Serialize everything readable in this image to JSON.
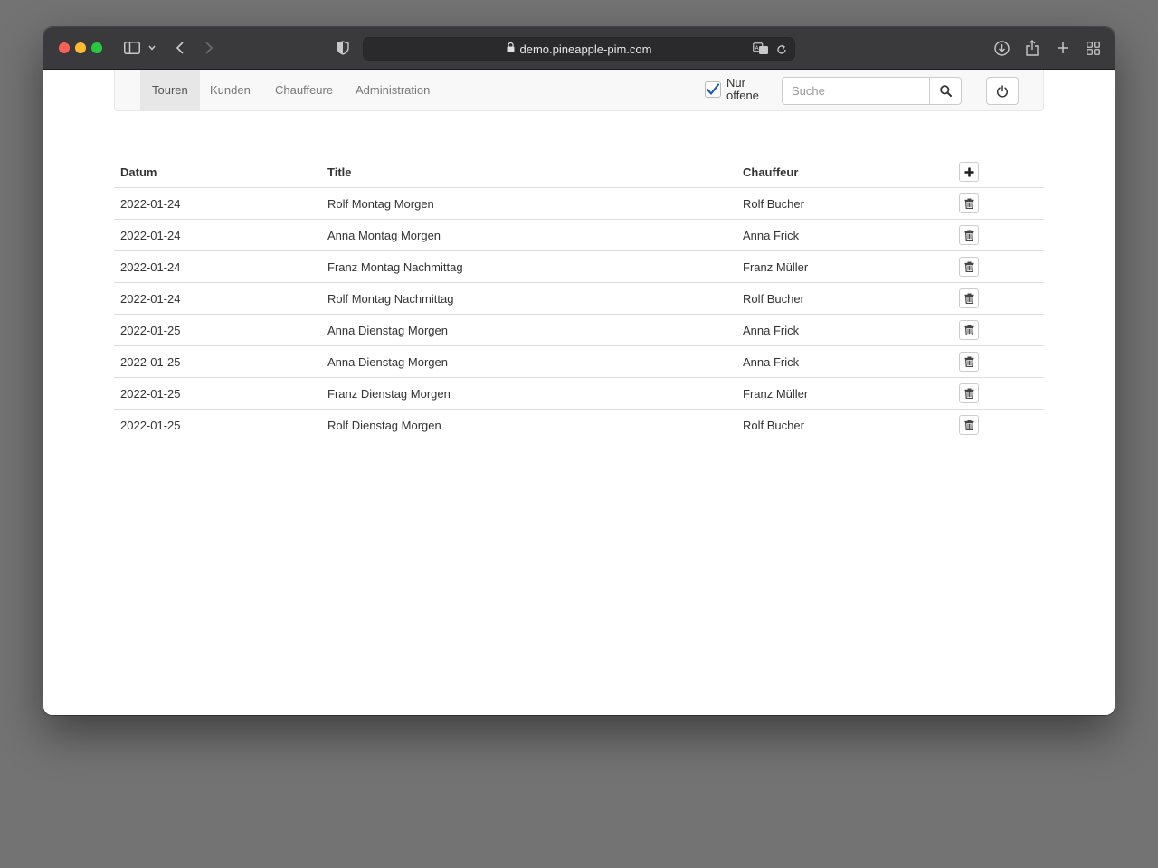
{
  "browser": {
    "url": "demo.pineapple-pim.com"
  },
  "nav": {
    "items": [
      {
        "label": "Touren",
        "active": true
      },
      {
        "label": "Kunden",
        "active": false
      },
      {
        "label": "Chauffeure",
        "active": false
      },
      {
        "label": "Administration",
        "active": false
      }
    ],
    "filter_label": "Nur offene",
    "filter_checked": true,
    "search_placeholder": "Suche",
    "search_value": ""
  },
  "table": {
    "headers": {
      "date": "Datum",
      "title": "Title",
      "driver": "Chauffeur"
    },
    "rows": [
      {
        "date": "2022-01-24",
        "title": "Rolf Montag Morgen",
        "driver": "Rolf Bucher"
      },
      {
        "date": "2022-01-24",
        "title": "Anna Montag Morgen",
        "driver": "Anna Frick"
      },
      {
        "date": "2022-01-24",
        "title": "Franz Montag Nachmittag",
        "driver": "Franz Müller"
      },
      {
        "date": "2022-01-24",
        "title": "Rolf Montag Nachmittag",
        "driver": "Rolf Bucher"
      },
      {
        "date": "2022-01-25",
        "title": "Anna Dienstag Morgen",
        "driver": "Anna Frick"
      },
      {
        "date": "2022-01-25",
        "title": "Anna Dienstag Morgen",
        "driver": "Anna Frick"
      },
      {
        "date": "2022-01-25",
        "title": "Franz Dienstag Morgen",
        "driver": "Franz Müller"
      },
      {
        "date": "2022-01-25",
        "title": "Rolf Dienstag Morgen",
        "driver": "Rolf Bucher"
      }
    ]
  },
  "icons": {
    "add": "plus-icon",
    "delete": "trash-icon",
    "search": "search-icon",
    "logout": "power-icon"
  },
  "colors": {
    "checkbox_accent": "#1a5fb4",
    "navbar_bg": "#f8f8f8",
    "active_tab_bg": "#e7e7e7"
  }
}
